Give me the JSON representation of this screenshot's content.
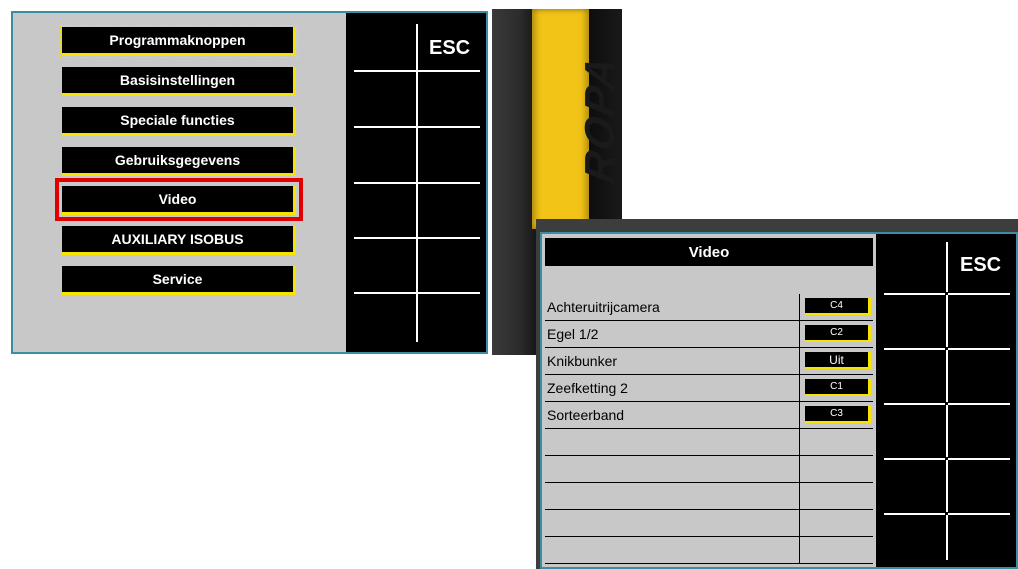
{
  "left_screen": {
    "menu": [
      {
        "label": "Programmaknoppen"
      },
      {
        "label": "Basisinstellingen"
      },
      {
        "label": "Speciale functies"
      },
      {
        "label": "Gebruiksgegevens"
      },
      {
        "label": "Video"
      },
      {
        "label": "AUXILIARY ISOBUS"
      },
      {
        "label": "Service"
      }
    ],
    "esc_label": "ESC"
  },
  "ropa": {
    "logo_text": "ROPA"
  },
  "right_screen": {
    "title": "Video",
    "esc_label": "ESC",
    "rows": [
      {
        "name": "Achteruitrijcamera",
        "value": "C4"
      },
      {
        "name": "Egel 1/2",
        "value": "C2"
      },
      {
        "name": "Knikbunker",
        "value": "Uit"
      },
      {
        "name": "Zeefketting 2",
        "value": "C1"
      },
      {
        "name": "Sorteerband",
        "value": "C3"
      },
      {
        "name": "",
        "value": ""
      },
      {
        "name": "",
        "value": ""
      },
      {
        "name": "",
        "value": ""
      },
      {
        "name": "",
        "value": ""
      },
      {
        "name": "",
        "value": ""
      }
    ]
  },
  "colors": {
    "accent_yellow": "#f5e400",
    "highlight_red": "#e00000",
    "screen_bg": "#c8c8c8",
    "screen_border": "#3a8ea0"
  }
}
